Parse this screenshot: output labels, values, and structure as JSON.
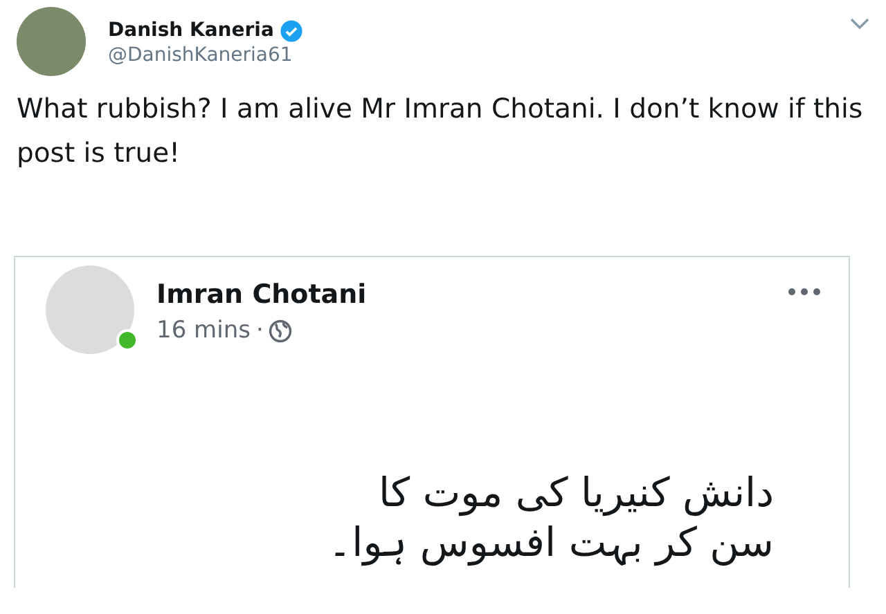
{
  "tweet": {
    "author": {
      "name": "Danish Kaneria",
      "verified": true,
      "handle": "@DanishKaneria61"
    },
    "text": "What rubbish? I am alive Mr Imran Chotani. I don’t know if this post is true!",
    "embedded_post": {
      "author": {
        "name": "Imran Chotani",
        "online": true
      },
      "time": "16 mins",
      "separator": "·",
      "lines": [
        "دانش کنیریا کی موت کا",
        "سن کر بہت افسوس ہوا۔"
      ]
    }
  }
}
